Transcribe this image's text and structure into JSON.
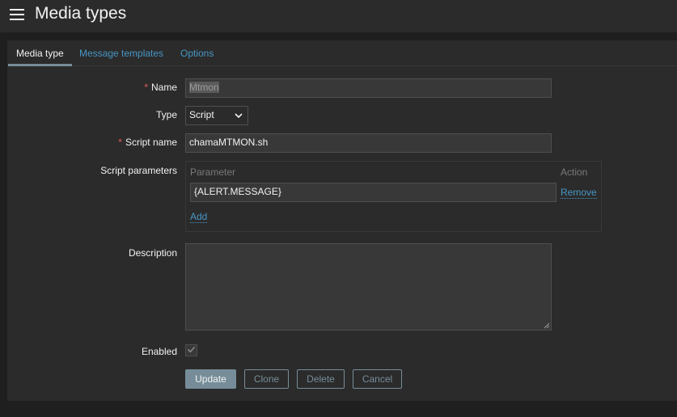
{
  "header": {
    "title": "Media types",
    "menu_icon": "hamburger-menu-icon"
  },
  "tabs": [
    {
      "label": "Media type",
      "active": true
    },
    {
      "label": "Message templates",
      "active": false
    },
    {
      "label": "Options",
      "active": false
    }
  ],
  "form": {
    "name": {
      "label": "Name",
      "required": true,
      "value": "Mtmon"
    },
    "type": {
      "label": "Type",
      "value": "Script"
    },
    "script_name": {
      "label": "Script name",
      "required": true,
      "value": "chamaMTMON.sh"
    },
    "script_parameters": {
      "label": "Script parameters",
      "column_parameter": "Parameter",
      "column_action": "Action",
      "rows": [
        {
          "value": "{ALERT.MESSAGE}",
          "action": "Remove"
        }
      ],
      "add_label": "Add"
    },
    "description": {
      "label": "Description",
      "value": ""
    },
    "enabled": {
      "label": "Enabled",
      "checked": true
    }
  },
  "buttons": {
    "update": "Update",
    "clone": "Clone",
    "delete": "Delete",
    "cancel": "Cancel"
  },
  "colors": {
    "background": "#1f1f1f",
    "panel": "#2b2b2b",
    "link": "#4796c4",
    "required": "#e45959",
    "button": "#768d99"
  }
}
